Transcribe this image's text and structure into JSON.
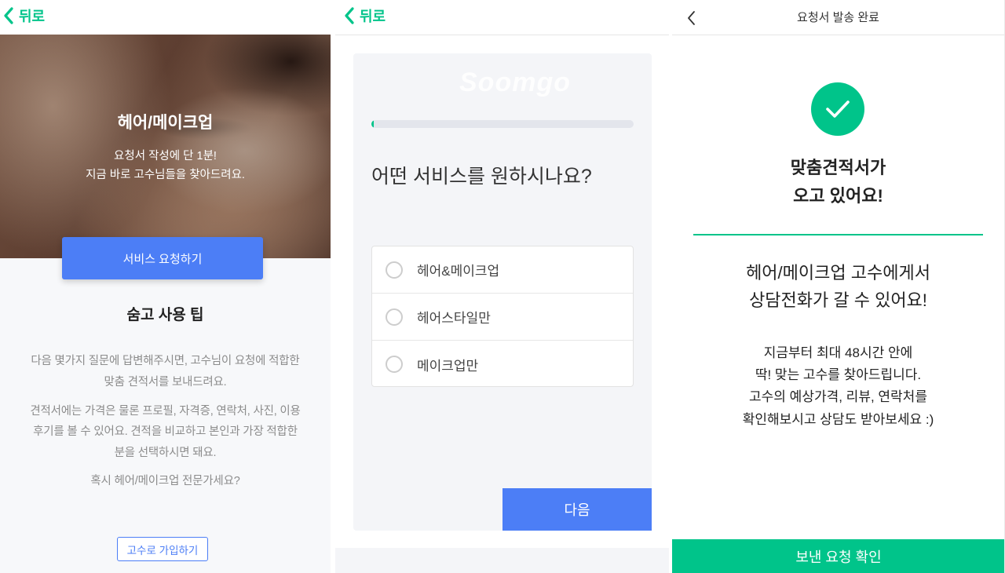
{
  "colors": {
    "accent_green": "#00c48a",
    "primary_blue": "#4c7ef6"
  },
  "intro": {
    "back_label": "뒤로",
    "back_icon": "chevron-left-icon",
    "hero": {
      "title": "헤어/메이크업",
      "lines": [
        "요청서 작성에 단 1분!",
        "지금 바로 고수님들을 찾아드려요."
      ]
    },
    "request_button": "서비스 요청하기",
    "tips_title": "숨고 사용 팁",
    "tips": [
      [
        "다음 몇가지 질문에 답변해주시면, 고수님이 요청에 적합한",
        "맞춤 견적서를 보내드려요."
      ],
      [
        "견적서에는 가격은 물론 프로필, 자격증, 연락처, 사진, 이용",
        "후기를 볼 수 있어요. 견적을 비교하고 본인과 가장 적합한",
        "분을 선택하시면 돼요."
      ]
    ],
    "pro_question": "혹시 헤어/메이크업 전문가세요?",
    "pro_signup_button": "고수로 가입하기"
  },
  "question": {
    "back_label": "뒤로",
    "back_icon": "chevron-left-icon",
    "watermark_logo": "Soomgo",
    "progress_percent": 1,
    "title": "어떤 서비스를 원하시나요?",
    "options": [
      {
        "label": "헤어&메이크업",
        "selected": false
      },
      {
        "label": "헤어스타일만",
        "selected": false
      },
      {
        "label": "메이크업만",
        "selected": false
      }
    ],
    "next_button": "다음"
  },
  "complete": {
    "back_icon": "chevron-left-icon",
    "title": "요청서 발송 완료",
    "status_icon": "check-icon",
    "headline": [
      "맞춤견적서가",
      "오고 있어요!"
    ],
    "subheadline": [
      "헤어/메이크업 고수에게서",
      "상담전화가 갈 수 있어요!"
    ],
    "body": [
      "지금부터 최대 48시간 안에",
      "딱! 맞는 고수를 찾아드립니다.",
      "고수의 예상가격, 리뷰, 연락처를",
      "확인해보시고 상담도 받아보세요 :)"
    ],
    "confirm_button": "보낸 요청 확인"
  }
}
